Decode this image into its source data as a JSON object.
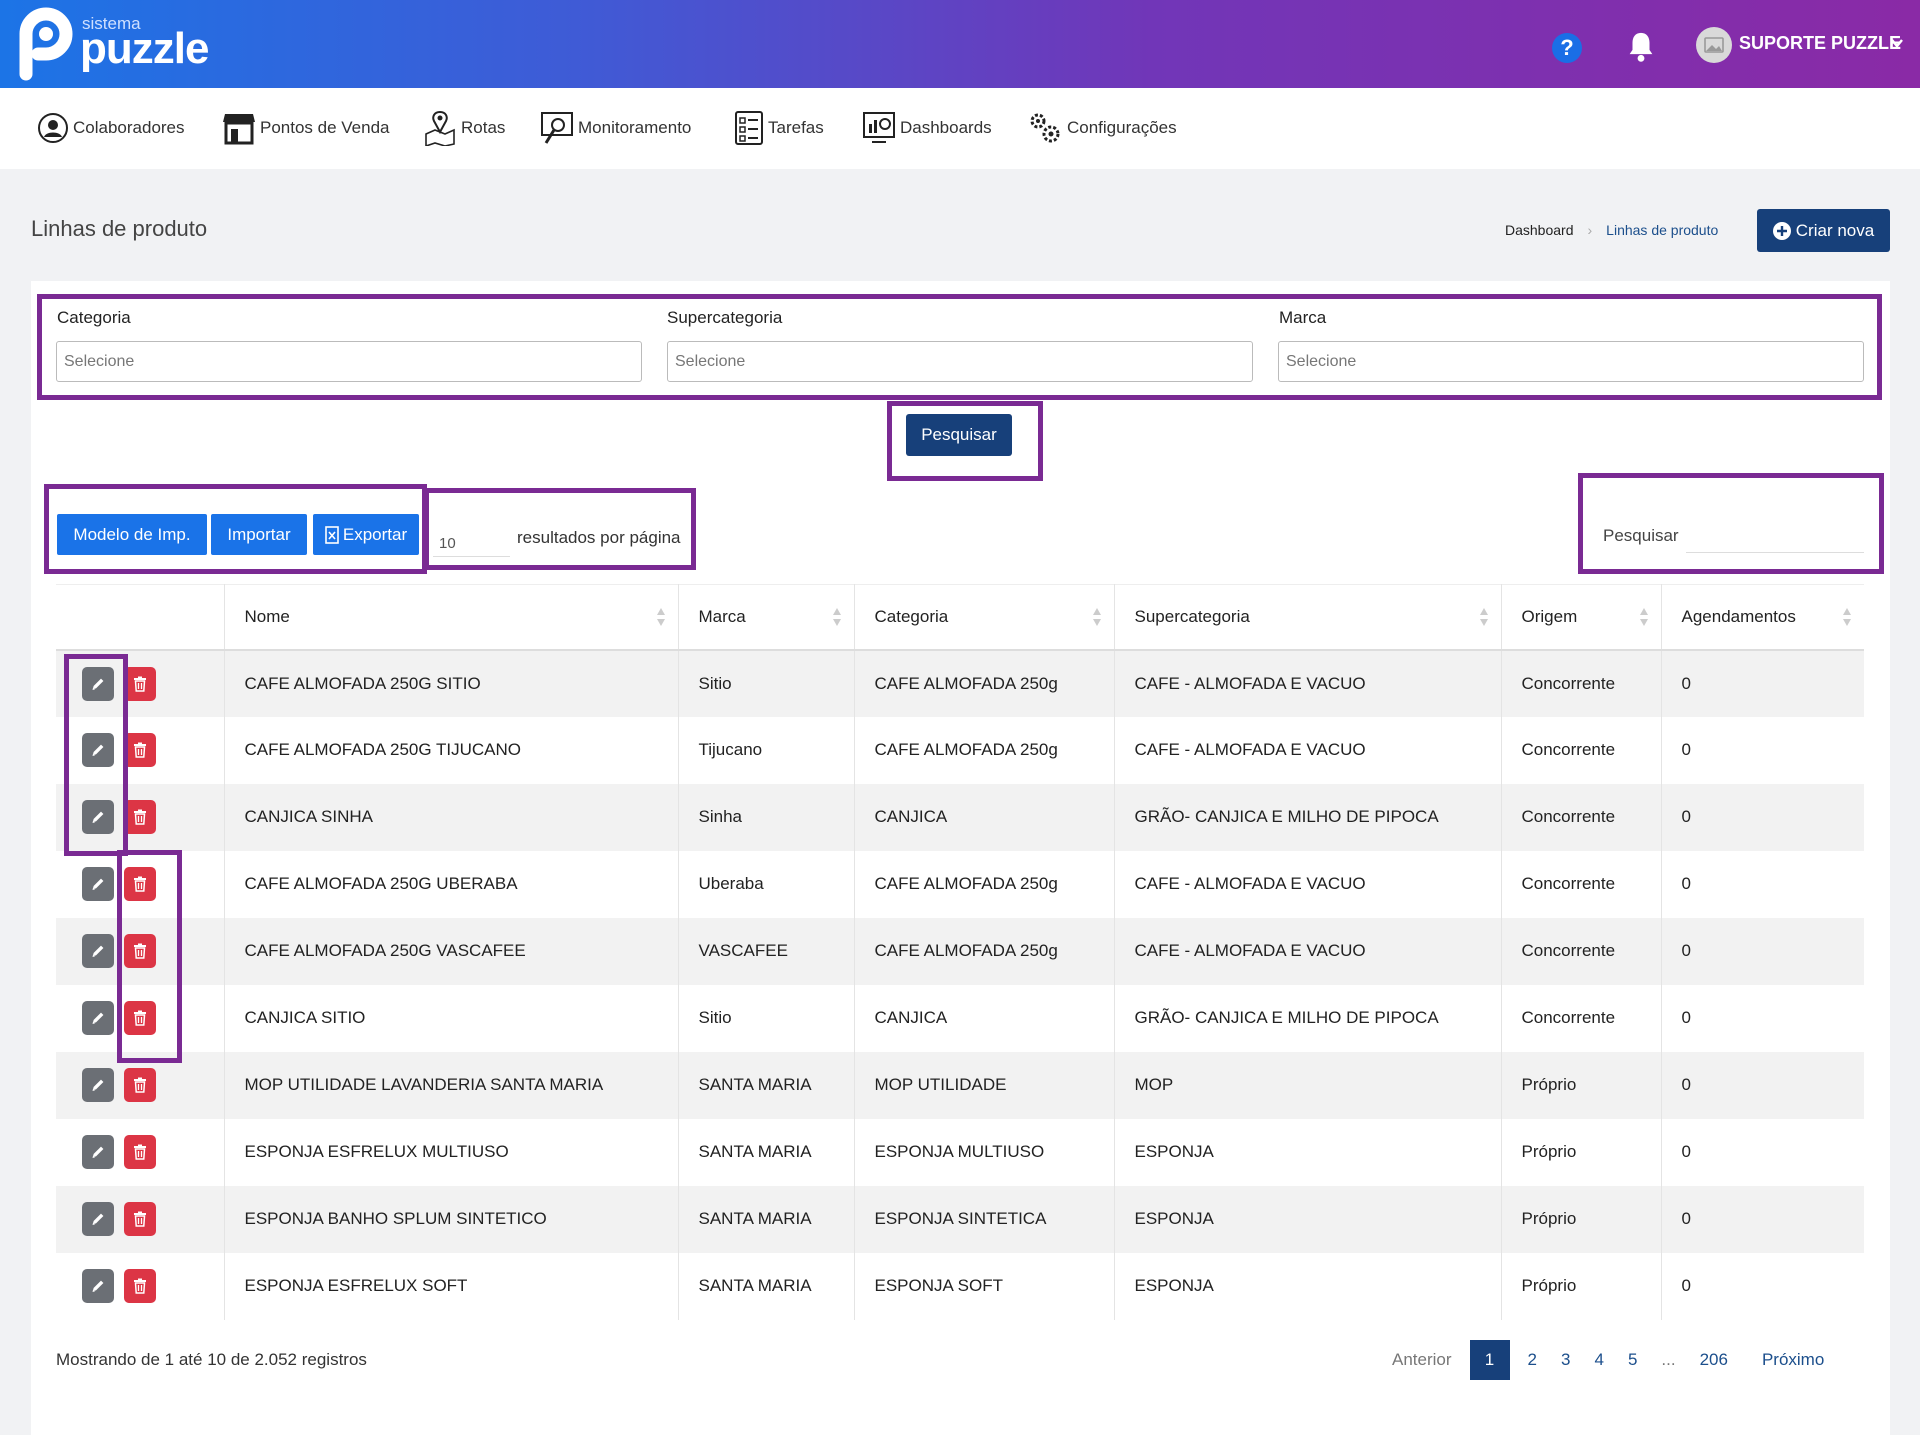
{
  "header": {
    "logo_sub": "sistema",
    "logo_main": "puzzle",
    "help_label": "?",
    "user_name": "SUPORTE PUZZLE"
  },
  "nav": [
    {
      "label": "Colaboradores",
      "icon": "user-circle-icon"
    },
    {
      "label": "Pontos de Venda",
      "icon": "store-icon"
    },
    {
      "label": "Rotas",
      "icon": "map-pin-icon"
    },
    {
      "label": "Monitoramento",
      "icon": "monitor-search-icon"
    },
    {
      "label": "Tarefas",
      "icon": "checklist-icon"
    },
    {
      "label": "Dashboards",
      "icon": "dashboard-icon"
    },
    {
      "label": "Configurações",
      "icon": "gears-icon"
    }
  ],
  "page": {
    "title": "Linhas de produto",
    "breadcrumb": [
      "Dashboard",
      "Linhas de produto"
    ],
    "new_button": "Criar nova"
  },
  "filters": {
    "categoria": {
      "label": "Categoria",
      "placeholder": "Selecione"
    },
    "supercategoria": {
      "label": "Supercategoria",
      "placeholder": "Selecione"
    },
    "marca": {
      "label": "Marca",
      "placeholder": "Selecione"
    },
    "search_button": "Pesquisar"
  },
  "toolbar": {
    "model_button": "Modelo de Imp.",
    "import_button": "Importar",
    "export_button": "Exportar",
    "per_page_value": "10",
    "per_page_label": "resultados por página",
    "search_label": "Pesquisar"
  },
  "table": {
    "columns": [
      "Nome",
      "Marca",
      "Categoria",
      "Supercategoria",
      "Origem",
      "Agendamentos"
    ],
    "rows": [
      [
        "CAFE ALMOFADA 250G SITIO",
        "Sitio",
        "CAFE ALMOFADA 250g",
        "CAFE - ALMOFADA E VACUO",
        "Concorrente",
        "0"
      ],
      [
        "CAFE ALMOFADA 250G TIJUCANO",
        "Tijucano",
        "CAFE ALMOFADA 250g",
        "CAFE - ALMOFADA E VACUO",
        "Concorrente",
        "0"
      ],
      [
        "CANJICA SINHA",
        "Sinha",
        "CANJICA",
        "GRÃO- CANJICA E MILHO DE PIPOCA",
        "Concorrente",
        "0"
      ],
      [
        "CAFE ALMOFADA 250G UBERABA",
        "Uberaba",
        "CAFE ALMOFADA 250g",
        "CAFE - ALMOFADA E VACUO",
        "Concorrente",
        "0"
      ],
      [
        "CAFE ALMOFADA 250G VASCAFEE",
        "VASCAFEE",
        "CAFE ALMOFADA 250g",
        "CAFE - ALMOFADA E VACUO",
        "Concorrente",
        "0"
      ],
      [
        "CANJICA SITIO",
        "Sitio",
        "CANJICA",
        "GRÃO- CANJICA E MILHO DE PIPOCA",
        "Concorrente",
        "0"
      ],
      [
        "MOP UTILIDADE LAVANDERIA SANTA MARIA",
        "SANTA MARIA",
        "MOP UTILIDADE",
        "MOP",
        "Próprio",
        "0"
      ],
      [
        "ESPONJA ESFRELUX MULTIUSO",
        "SANTA MARIA",
        "ESPONJA MULTIUSO",
        "ESPONJA",
        "Próprio",
        "0"
      ],
      [
        "ESPONJA BANHO SPLUM SINTETICO",
        "SANTA MARIA",
        "ESPONJA SINTETICA",
        "ESPONJA",
        "Próprio",
        "0"
      ],
      [
        "ESPONJA ESFRELUX SOFT",
        "SANTA MARIA",
        "ESPONJA SOFT",
        "ESPONJA",
        "Próprio",
        "0"
      ]
    ]
  },
  "footer": {
    "info": "Mostrando de 1 até 10 de 2.052 registros",
    "pagination": {
      "prev": "Anterior",
      "pages": [
        "1",
        "2",
        "3",
        "4",
        "5",
        "...",
        "206"
      ],
      "current": "1",
      "next": "Próximo"
    }
  },
  "colors": {
    "accent_dark": "#17407a",
    "accent_blue": "#1a73e8",
    "danger": "#dc3545",
    "highlight": "#7a2a93"
  }
}
